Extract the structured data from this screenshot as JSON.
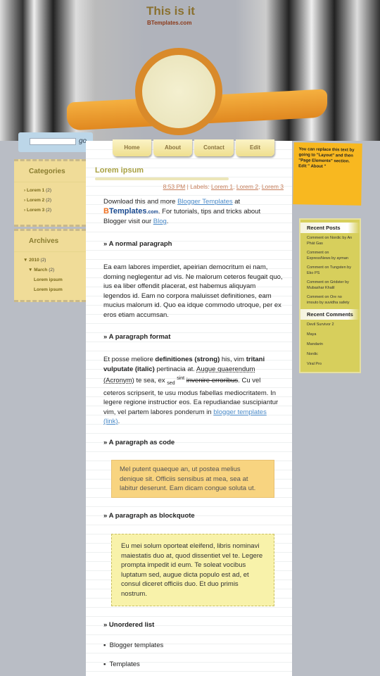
{
  "header": {
    "title": "This is it",
    "subtitle": "BTemplates.com"
  },
  "search": {
    "placeholder": "",
    "button": "go"
  },
  "nav": [
    "Home",
    "About",
    "Contact",
    "Edit"
  ],
  "sidebar": {
    "categories": {
      "title": "Categories",
      "items": [
        {
          "label": "Lorem 1",
          "count": "(2)"
        },
        {
          "label": "Lorem 2",
          "count": "(2)"
        },
        {
          "label": "Lorem 3",
          "count": "(2)"
        }
      ]
    },
    "archives": {
      "title": "Archives",
      "year": "2010",
      "year_count": "(2)",
      "month": "March",
      "month_count": "(2)",
      "posts": [
        "Lorem ipsum",
        "Lorem ipsum"
      ]
    }
  },
  "post": {
    "title": "Lorem ipsum",
    "time": "8:53 PM",
    "labels_prefix": " | Labels: ",
    "labels": [
      "Lorem 1",
      "Lorem 2",
      "Lorem 3"
    ],
    "intro_1": "Download this and more ",
    "intro_link": "Blogger Templates",
    "intro_2": " at",
    "logo_b": "B",
    "logo_text": "Templates",
    "logo_com": ".com",
    "intro_3": ". For tutorials, tips and tricks about Blogger visit our ",
    "blog_link": "Blog",
    "intro_4": ".",
    "h_normal": "» A normal paragraph",
    "normal": "Ea eam labores imperdiet, apeirian democritum ei nam, doming neglegentur ad vis. Ne malorum ceteros feugait quo, ius ea liber offendit placerat, est habemus aliquyam legendos id. Eam no corpora maluisset definitiones, eam mucius malorum id. Quo ea idque commodo utroque, per ex eros etiam accumsan.",
    "h_format": "» A paragraph format",
    "f1": "Et posse meliore ",
    "f_strong": "definitiones (strong)",
    "f2": " his, vim ",
    "f_italic": "tritani vulputate (italic)",
    "f3": " pertinacia at. ",
    "f_acr": "Augue quaerendum (Acronym)",
    "f4": " te sea, ex ",
    "f_sub": "sed",
    "f_sup": "sint",
    "f_del": "invenire erroribus",
    "f5": ". Cu vel ceteros scripserit, te usu modus fabellas mediocritatem. In legere regione instructior eos. Ea repudiandae suscipiantur vim, vel partem labores ponderum in ",
    "f_link": "blogger templates (link)",
    "f6": ".",
    "h_code": "» A paragraph as code",
    "code": "Mel putent quaeque an, ut postea melius denique sit. Officiis sensibus at mea, sea at labitur deserunt. Eam dicam congue soluta ut.",
    "h_quote": "» A paragraph as blockquote",
    "quote": "Eu mei solum oporteat eleifend, libris nominavi maiestatis duo at, quod dissentiet vel te. Legere prompta impedit id eum. Te soleat vocibus luptatum sed, augue dicta populo est ad, et consul diceret officiis duo. Et duo primis nostrum.",
    "h_list": "» Unordered list",
    "list": [
      "Blogger templates",
      "Templates"
    ]
  },
  "note": "You can replace this text by going to \"Layout\" and then \"Page Elements\" section. Edit \" About \"",
  "recent_posts": {
    "title": "Recent Posts",
    "items": [
      "Comment on Nordic by An Phát Gas",
      "Comment on ExpressNews by ayman",
      "Comment on Tungsten by Eko PS",
      "Comment on Gridster by Mubashar Khalil",
      "Comment on Ore no imouto by suvidha safety"
    ]
  },
  "recent_comments": {
    "title": "Recent Comments",
    "items": [
      "Devil Survivor 2",
      "Maya",
      "Mandarin",
      "Nordic",
      "Viral Pro"
    ]
  }
}
